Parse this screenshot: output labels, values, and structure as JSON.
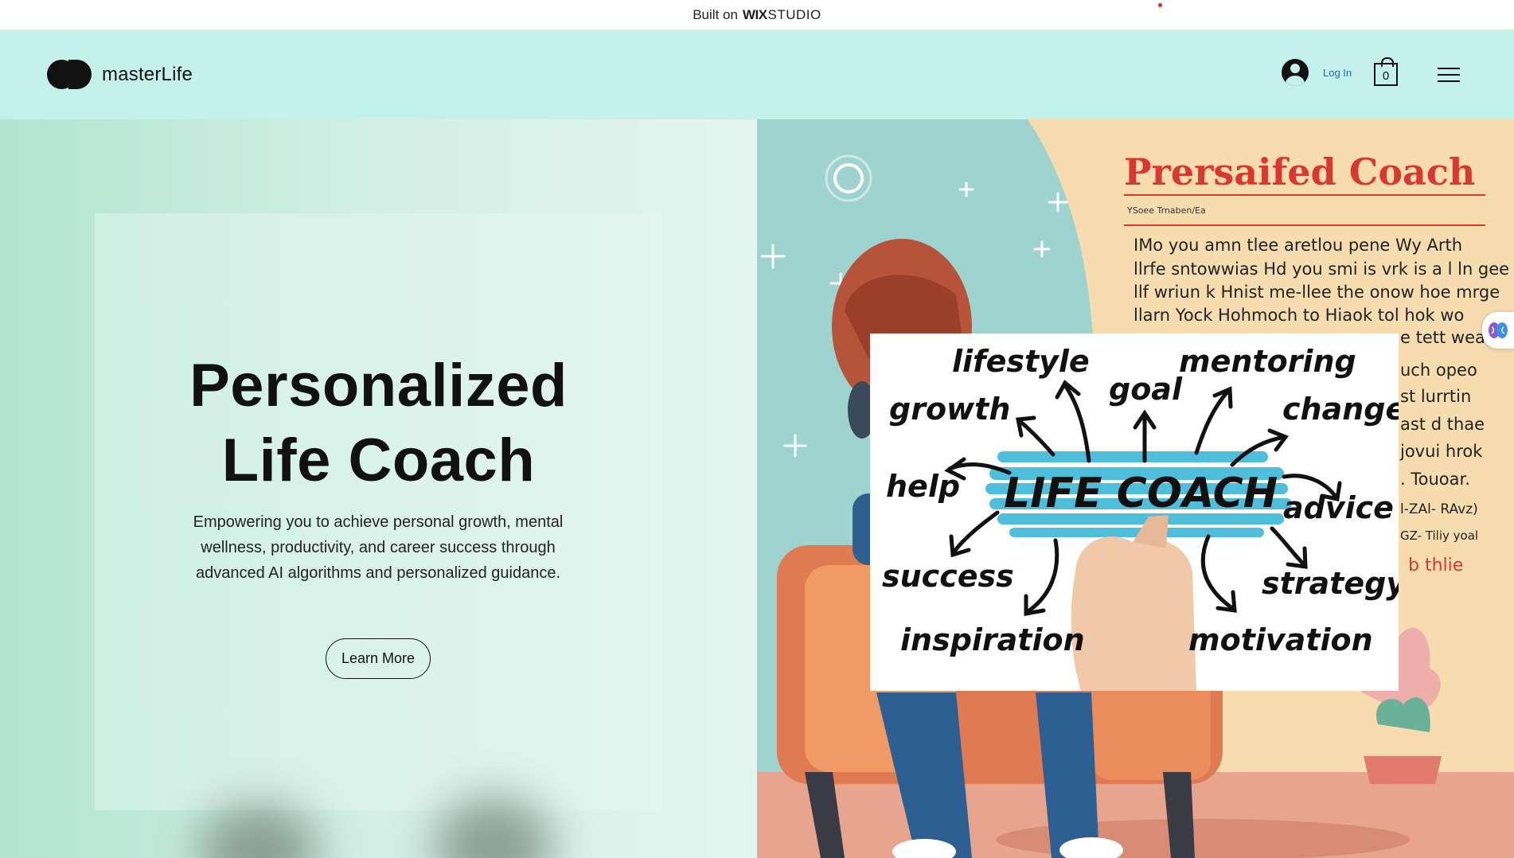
{
  "banner": {
    "prefix": "Built on",
    "wix": "WIX",
    "studio": "STUDIO"
  },
  "header": {
    "brand": "masterLife",
    "login_label": "Log In",
    "cart_count": "0",
    "icons": {
      "logo": "masterlife-logo-icon",
      "avatar": "user-avatar-icon",
      "cart": "shopping-bag-icon",
      "menu": "hamburger-menu-icon"
    }
  },
  "hero": {
    "title_line1": "Personalized",
    "title_line2": "Life Coach",
    "subtitle": "Empowering you to achieve personal growth, mental wellness, productivity, and career success through advanced AI algorithms and personalized guidance.",
    "cta_label": "Learn More"
  },
  "illustration": {
    "poster_title": "Prersaifed Coach",
    "poster_byline": "YSoee Trnaben/Ea",
    "poster_lines": [
      "IMo you amn tlee aretlou pene Wy Arth",
      "llrfe sntowwias Hd you smi is vrk is a l ln gee",
      "llf wriun k Hnist me-llee the onow hoe mrge",
      "llarn Yock Hohmoch to Hiaok tol hok wo",
      "e tett wea",
      "uch opeo",
      "st lurrtin",
      "ast d thae",
      "jovui hrok",
      ". Touoar.",
      "l-ZAl- RAvz)",
      "GZ- Tiliy yoal",
      "b thlie"
    ],
    "card_words": [
      "lifestyle",
      "mentoring",
      "goal",
      "growth",
      "change",
      "help",
      "LIFE COACH",
      "advice",
      "success",
      "strategy",
      "inspiration",
      "motivation"
    ]
  },
  "colors": {
    "header_bg": "#c4f2ea",
    "login_blue": "#1b63d6",
    "poster_red": "#d9382f"
  },
  "widget": {
    "icon": "brain-icon"
  }
}
